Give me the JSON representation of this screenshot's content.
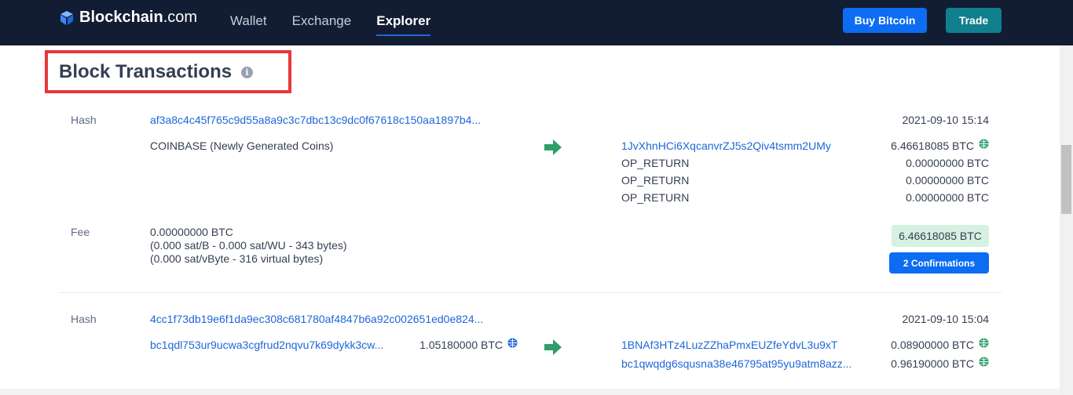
{
  "header": {
    "logo_brand": "Blockchain",
    "logo_domain": ".com",
    "nav": [
      {
        "label": "Wallet"
      },
      {
        "label": "Exchange"
      },
      {
        "label": "Explorer"
      }
    ],
    "buy_label": "Buy Bitcoin",
    "trade_label": "Trade",
    "colors": {
      "bar": "#121d33",
      "buy": "#0c6cf2",
      "trade": "#10808d"
    }
  },
  "section": {
    "title": "Block Transactions",
    "info_icon": "i"
  },
  "tx1": {
    "hash_label": "Hash",
    "hash": "af3a8c4c45f765c9d55a8a9c3c7dbc13c9dc0f67618c150aa1897b4...",
    "time": "2021-09-10 15:14",
    "input": "COINBASE (Newly Generated Coins)",
    "outputs": [
      {
        "address": "1JvXhnHCi6XqcanvrZJ5s2Qiv4tsmm2UMy",
        "amount": "6.46618085 BTC",
        "globe": true
      },
      {
        "address": "OP_RETURN",
        "amount": "0.00000000 BTC",
        "globe": false
      },
      {
        "address": "OP_RETURN",
        "amount": "0.00000000 BTC",
        "globe": false
      },
      {
        "address": "OP_RETURN",
        "amount": "0.00000000 BTC",
        "globe": false
      }
    ],
    "fee_label": "Fee",
    "fee_lines": [
      "0.00000000 BTC",
      "(0.000 sat/B - 0.000 sat/WU - 343 bytes)",
      "(0.000 sat/vByte - 316 virtual bytes)"
    ],
    "total": "6.46618085 BTC",
    "confirmations": "2 Confirmations"
  },
  "tx2": {
    "hash_label": "Hash",
    "hash": "4cc1f73db19e6f1da9ec308c681780af4847b6a92c002651ed0e824...",
    "time": "2021-09-10 15:04",
    "input_address": "bc1qdl753ur9ucwa3cgfrud2nqvu7k69dykk3cw...",
    "input_amount": "1.05180000 BTC",
    "outputs": [
      {
        "address": "1BNAf3HTz4LuzZZhaPmxEUZfeYdvL3u9xT",
        "amount": "0.08900000 BTC"
      },
      {
        "address": "bc1qwqdg6squsna38e46795at95yu9atm8azz...",
        "amount": "0.96190000 BTC"
      }
    ]
  },
  "icons": {
    "arrow": "arrow-right-icon",
    "globe": "globe-icon",
    "info": "info-icon"
  }
}
